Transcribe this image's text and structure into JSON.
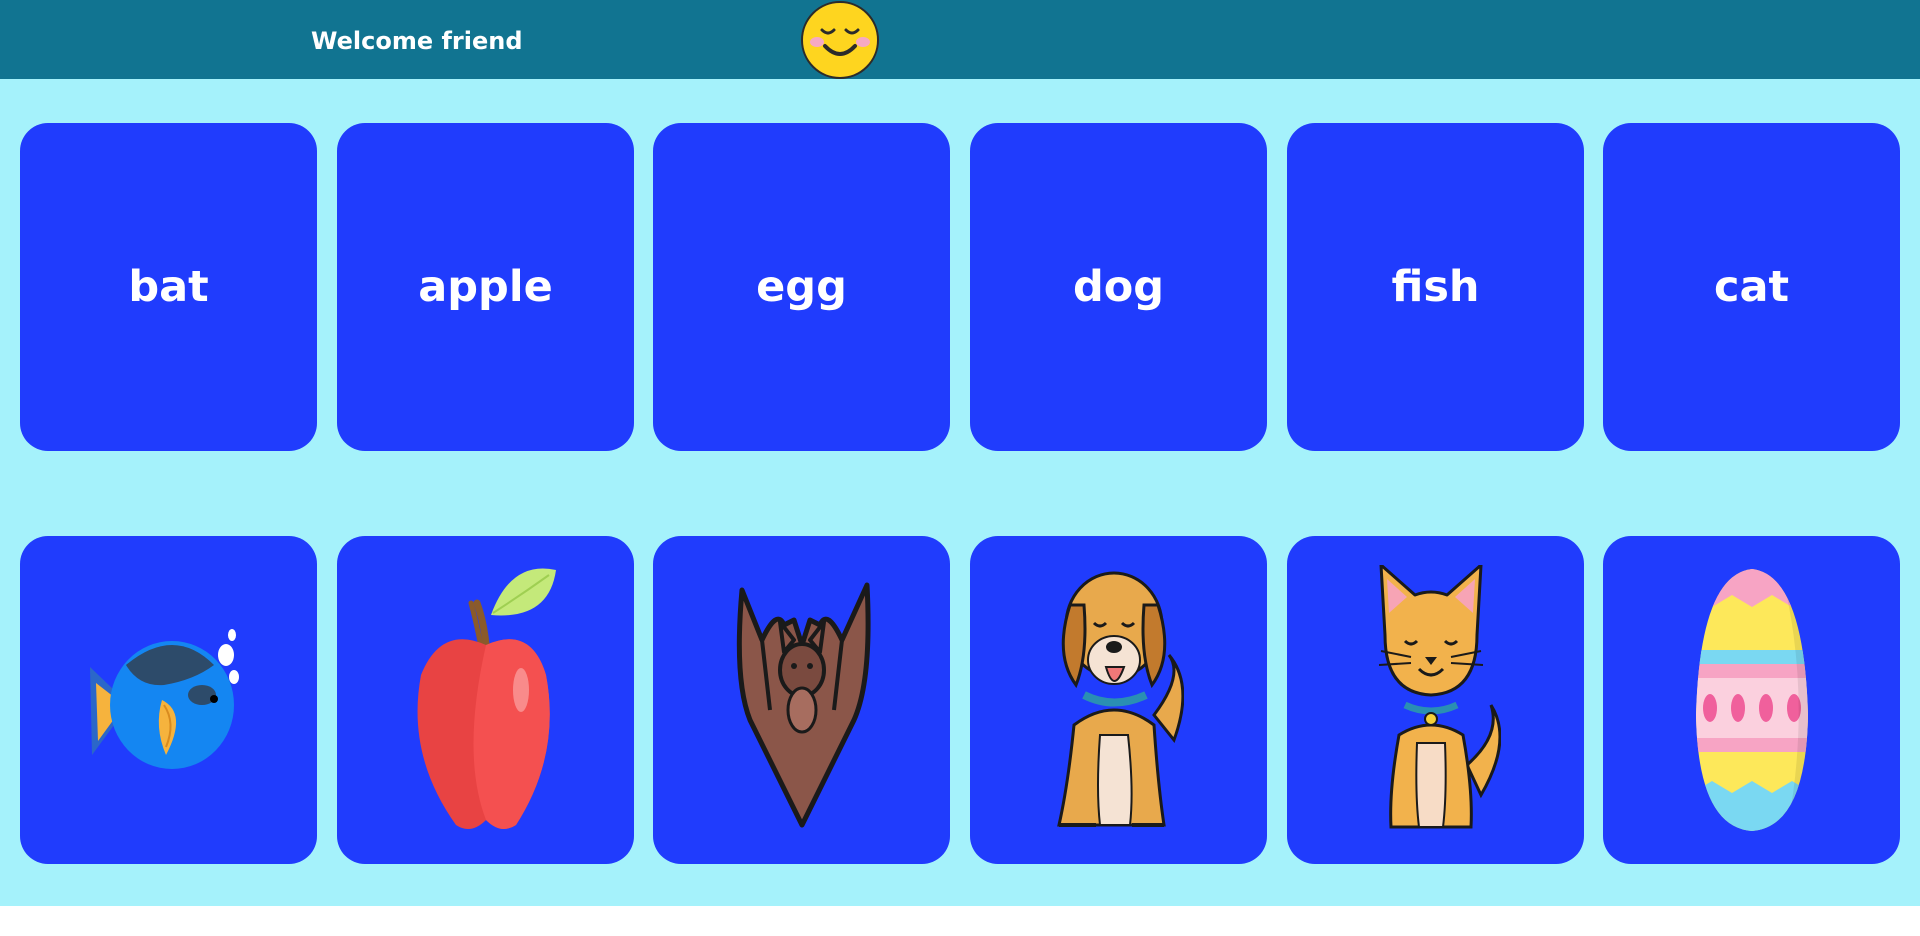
{
  "header": {
    "greeting": "Welcome friend",
    "mascot_icon": "sleepy-smiley-icon",
    "background_color": "#117491"
  },
  "board": {
    "background_color": "#a5f2fb",
    "card_color": "#203cfd",
    "word_cards": [
      {
        "label": "bat"
      },
      {
        "label": "apple"
      },
      {
        "label": "egg"
      },
      {
        "label": "dog"
      },
      {
        "label": "fish"
      },
      {
        "label": "cat"
      }
    ],
    "picture_cards": [
      {
        "icon": "fish-icon"
      },
      {
        "icon": "apple-icon"
      },
      {
        "icon": "bat-icon"
      },
      {
        "icon": "dog-icon"
      },
      {
        "icon": "cat-icon"
      },
      {
        "icon": "easter-egg-icon"
      }
    ]
  }
}
